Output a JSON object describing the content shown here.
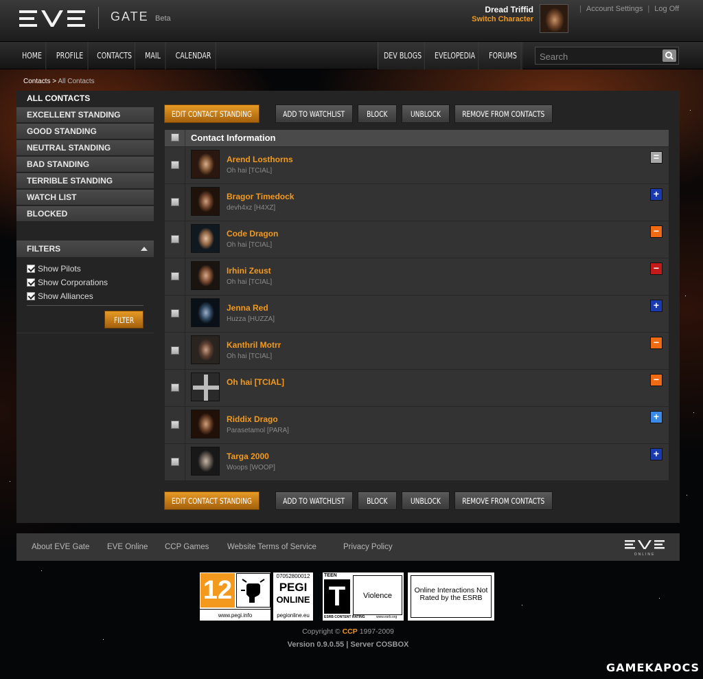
{
  "header": {
    "logo_text": "EVE",
    "app_name": "GATE",
    "badge": "Beta",
    "character_name": "Dread Triffid",
    "switch_character": "Switch Character",
    "account_settings": "Account Settings",
    "log_off": "Log Off"
  },
  "nav": {
    "left": [
      "HOME",
      "PROFILE",
      "CONTACTS",
      "MAIL",
      "CALENDAR"
    ],
    "right": [
      "DEV BLOGS",
      "EVELOPEDIA",
      "FORUMS"
    ],
    "search_placeholder": "Search"
  },
  "breadcrumb": {
    "parent": "Contacts",
    "separator": ">",
    "current": "All Contacts"
  },
  "sidebar": {
    "items": [
      {
        "label": "ALL CONTACTS"
      },
      {
        "label": "EXCELLENT STANDING"
      },
      {
        "label": "GOOD STANDING"
      },
      {
        "label": "NEUTRAL STANDING"
      },
      {
        "label": "BAD STANDING"
      },
      {
        "label": "TERRIBLE STANDING"
      },
      {
        "label": "WATCH LIST"
      },
      {
        "label": "BLOCKED"
      }
    ],
    "filters_title": "FILTERS",
    "filters": [
      {
        "label": "Show Pilots",
        "checked": true
      },
      {
        "label": "Show Corporations",
        "checked": true
      },
      {
        "label": "Show Alliances",
        "checked": true
      }
    ],
    "filter_button": "FILTER"
  },
  "actions": {
    "edit": "EDIT CONTACT STANDING",
    "watchlist": "ADD TO WATCHLIST",
    "block": "BLOCK",
    "unblock": "UNBLOCK",
    "remove": "REMOVE FROM CONTACTS"
  },
  "table": {
    "header": "Contact Information",
    "rows": [
      {
        "name": "Arend Losthorns",
        "corp": "Oh hai [TCIAL]",
        "standing": "neutral",
        "symbol": "="
      },
      {
        "name": "Bragor Timedock",
        "corp": "devh4xz [H4XZ]",
        "standing": "excellent",
        "symbol": "+"
      },
      {
        "name": "Code Dragon",
        "corp": "Oh hai [TCIAL]",
        "standing": "bad",
        "symbol": "−"
      },
      {
        "name": "Irhini Zeust",
        "corp": "Oh hai [TCIAL]",
        "standing": "terrible",
        "symbol": "−"
      },
      {
        "name": "Jenna Red",
        "corp": "Huzza [HUZZA]",
        "standing": "excellent",
        "symbol": "+"
      },
      {
        "name": "Kanthril Motrr",
        "corp": "Oh hai [TCIAL]",
        "standing": "bad",
        "symbol": "−"
      },
      {
        "name": "Oh hai [TCIAL]",
        "corp": "",
        "standing": "bad",
        "symbol": "−"
      },
      {
        "name": "Riddix Drago",
        "corp": "Parasetamol [PARA]",
        "standing": "good",
        "symbol": "+"
      },
      {
        "name": "Targa 2000",
        "corp": "Woops [WOOP]",
        "standing": "excellent",
        "symbol": "+"
      }
    ]
  },
  "footer": {
    "links": [
      "About EVE Gate",
      "EVE Online",
      "CCP Games",
      "Website Terms of Service",
      "Privacy Policy"
    ],
    "logo_text": "EVE",
    "logo_sub": "ONLINE",
    "ratings": {
      "pegi_age": "12",
      "pegi_site": "www.pegi.info",
      "pegi_online_code": "07052800012",
      "pegi_online_1": "PEGI",
      "pegi_online_2": "ONLINE",
      "pegi_online_site": "pegionline.eu",
      "esrb_teen": "TEEN",
      "esrb_letter": "T",
      "esrb_descriptor": "Violence",
      "esrb_content": "ESRB CONTENT RATING",
      "esrb_site": "www.esrb.org",
      "esrb_online_notice": "Online Interactions Not Rated by the ESRB"
    },
    "copyright_prefix": "Copyright ©",
    "copyright_company": "CCP",
    "copyright_years": "1997-2009",
    "version": "Version 0.9.0.55 | Server COSBOX"
  },
  "watermark": "GAMEKAPOCS",
  "colors": {
    "accent_orange": "#f39a1e",
    "excellent": "#1a3ab0",
    "good": "#3c8ae8",
    "neutral": "#a8a8a8",
    "bad": "#f06a14",
    "terrible": "#c41a1a"
  }
}
